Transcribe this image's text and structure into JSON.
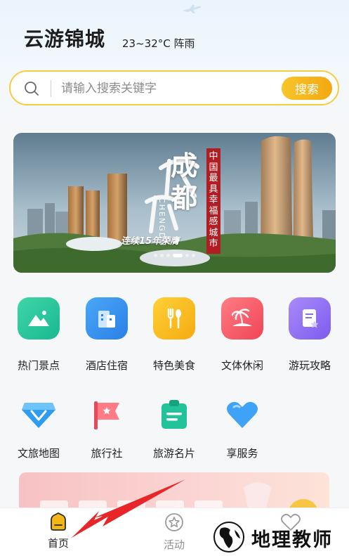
{
  "header": {
    "title": "云游锦城",
    "weather": "23~32°C 阵雨"
  },
  "search": {
    "placeholder": "请输入搜索关键字",
    "button_label": "搜索",
    "accent": "#f6cd3f"
  },
  "banner": {
    "vertical_title": "成都",
    "pinyin": "CHENGDU",
    "slogan": "连续15年荣膺",
    "red_label": "中国最具幸福感城市",
    "page_count": 6,
    "active_index": 3
  },
  "grid": {
    "items": [
      {
        "label": "热门景点",
        "icon": "mountain-photo-icon"
      },
      {
        "label": "酒店住宿",
        "icon": "hotel-building-icon"
      },
      {
        "label": "特色美食",
        "icon": "fork-spoon-icon"
      },
      {
        "label": "文体休闲",
        "icon": "palm-island-icon"
      },
      {
        "label": "游玩攻略",
        "icon": "guide-document-icon"
      },
      {
        "label": "文旅地图",
        "icon": "diamond-map-icon"
      },
      {
        "label": "旅行社",
        "icon": "travel-flag-icon"
      },
      {
        "label": "旅游名片",
        "icon": "card-badge-icon"
      },
      {
        "label": "享服务",
        "icon": "heart-icon"
      }
    ]
  },
  "tabbar": {
    "tabs": [
      {
        "label": "首页",
        "icon": "home-icon",
        "active": true
      },
      {
        "label": "活动",
        "icon": "star-circle-icon",
        "active": false
      },
      {
        "label": "",
        "icon": "heart-outline-icon",
        "active": false
      }
    ]
  },
  "watermark": {
    "text": "地理教师"
  },
  "colors": {
    "accent_yellow": "#f6cd3f",
    "arrow_red": "#e8262a",
    "banner_red": "#b01e23"
  }
}
